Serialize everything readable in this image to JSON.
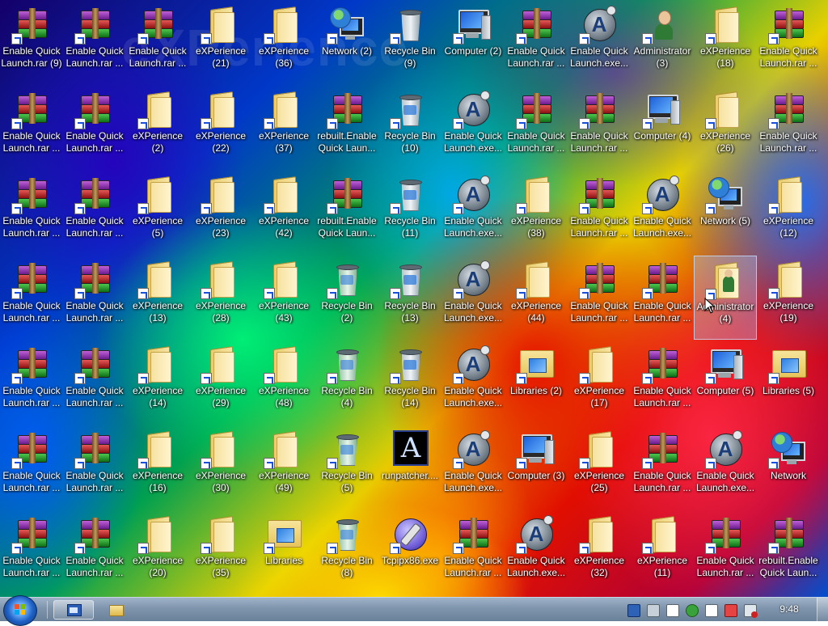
{
  "wallpaper": {
    "brand_text": "eXPerience"
  },
  "desktop_icons": [
    {
      "type": "rar",
      "label": "Enable Quick\nLaunch.rar (9)"
    },
    {
      "type": "rar",
      "label": "Enable Quick\nLaunch.rar ..."
    },
    {
      "type": "rar",
      "label": "Enable Quick\nLaunch.rar ..."
    },
    {
      "type": "folder",
      "label": "eXPerience\n(21)"
    },
    {
      "type": "folder",
      "label": "eXPerience\n(36)"
    },
    {
      "type": "network",
      "label": "Network (2)"
    },
    {
      "type": "bin-empty",
      "label": "Recycle Bin\n(9)"
    },
    {
      "type": "computer",
      "label": "Computer (2)"
    },
    {
      "type": "rar",
      "label": "Enable Quick\nLaunch.rar ..."
    },
    {
      "type": "exe",
      "label": "Enable Quick\nLaunch.exe..."
    },
    {
      "type": "user",
      "label": "Administrator\n(3)"
    },
    {
      "type": "folder",
      "label": "eXPerience\n(18)"
    },
    {
      "type": "rar",
      "label": "Enable Quick\nLaunch.rar ..."
    },
    {
      "type": "rar",
      "label": "Enable Quick\nLaunch.rar ..."
    },
    {
      "type": "rar",
      "label": "Enable Quick\nLaunch.rar ..."
    },
    {
      "type": "folder",
      "label": "eXPerience\n(2)"
    },
    {
      "type": "folder",
      "label": "eXPerience\n(22)"
    },
    {
      "type": "folder",
      "label": "eXPerience\n(37)"
    },
    {
      "type": "rar",
      "label": "rebuilt.Enable\nQuick Laun..."
    },
    {
      "type": "bin-full",
      "label": "Recycle Bin\n(10)"
    },
    {
      "type": "exe",
      "label": "Enable Quick\nLaunch.exe..."
    },
    {
      "type": "rar",
      "label": "Enable Quick\nLaunch.rar ..."
    },
    {
      "type": "rar",
      "label": "Enable Quick\nLaunch.rar ..."
    },
    {
      "type": "computer",
      "label": "Computer (4)"
    },
    {
      "type": "folder",
      "label": "eXPerience\n(26)"
    },
    {
      "type": "rar",
      "label": "Enable Quick\nLaunch.rar ..."
    },
    {
      "type": "rar",
      "label": "Enable Quick\nLaunch.rar ..."
    },
    {
      "type": "rar",
      "label": "Enable Quick\nLaunch.rar ..."
    },
    {
      "type": "folder",
      "label": "eXPerience\n(5)"
    },
    {
      "type": "folder",
      "label": "eXPerience\n(23)"
    },
    {
      "type": "folder",
      "label": "eXPerience\n(42)"
    },
    {
      "type": "rar",
      "label": "rebuilt.Enable\nQuick Laun..."
    },
    {
      "type": "bin-full",
      "label": "Recycle Bin\n(11)"
    },
    {
      "type": "exe",
      "label": "Enable Quick\nLaunch.exe..."
    },
    {
      "type": "folder",
      "label": "eXPerience\n(38)"
    },
    {
      "type": "rar",
      "label": "Enable Quick\nLaunch.rar ..."
    },
    {
      "type": "exe",
      "label": "Enable Quick\nLaunch.exe..."
    },
    {
      "type": "network",
      "label": "Network (5)"
    },
    {
      "type": "folder",
      "label": "eXPerience\n(12)"
    },
    {
      "type": "rar",
      "label": "Enable Quick\nLaunch.rar ..."
    },
    {
      "type": "rar",
      "label": "Enable Quick\nLaunch.rar ..."
    },
    {
      "type": "folder",
      "label": "eXPerience\n(13)"
    },
    {
      "type": "folder",
      "label": "eXPerience\n(28)"
    },
    {
      "type": "folder",
      "label": "eXPerience\n(43)"
    },
    {
      "type": "bin-green",
      "label": "Recycle Bin\n(2)"
    },
    {
      "type": "bin-full",
      "label": "Recycle Bin\n(13)"
    },
    {
      "type": "exe",
      "label": "Enable Quick\nLaunch.exe..."
    },
    {
      "type": "folder",
      "label": "eXPerience\n(44)"
    },
    {
      "type": "rar",
      "label": "Enable Quick\nLaunch.rar ..."
    },
    {
      "type": "rar",
      "label": "Enable Quick\nLaunch.rar ..."
    },
    {
      "type": "user-folder",
      "label": "Administrator\n(4)",
      "selected": true
    },
    {
      "type": "folder",
      "label": "eXPerience\n(19)"
    },
    {
      "type": "rar",
      "label": "Enable Quick\nLaunch.rar ..."
    },
    {
      "type": "rar",
      "label": "Enable Quick\nLaunch.rar ..."
    },
    {
      "type": "folder",
      "label": "eXPerience\n(14)"
    },
    {
      "type": "folder",
      "label": "eXPerience\n(29)"
    },
    {
      "type": "folder",
      "label": "eXPerience\n(48)"
    },
    {
      "type": "bin-green",
      "label": "Recycle Bin\n(4)"
    },
    {
      "type": "bin-full",
      "label": "Recycle Bin\n(14)"
    },
    {
      "type": "exe",
      "label": "Enable Quick\nLaunch.exe..."
    },
    {
      "type": "libraries",
      "label": "Libraries (2)"
    },
    {
      "type": "folder",
      "label": "eXPerience\n(17)"
    },
    {
      "type": "rar",
      "label": "Enable Quick\nLaunch.rar ..."
    },
    {
      "type": "computer",
      "label": "Computer (5)"
    },
    {
      "type": "libraries",
      "label": "Libraries (5)"
    },
    {
      "type": "rar",
      "label": "Enable Quick\nLaunch.rar ..."
    },
    {
      "type": "rar",
      "label": "Enable Quick\nLaunch.rar ..."
    },
    {
      "type": "folder",
      "label": "eXPerience\n(16)"
    },
    {
      "type": "folder",
      "label": "eXPerience\n(30)"
    },
    {
      "type": "folder",
      "label": "eXPerience\n(49)"
    },
    {
      "type": "bin-green",
      "label": "Recycle Bin\n(5)"
    },
    {
      "type": "runpatcher",
      "label": "runpatcher...."
    },
    {
      "type": "exe",
      "label": "Enable Quick\nLaunch.exe..."
    },
    {
      "type": "computer",
      "label": "Computer (3)"
    },
    {
      "type": "folder",
      "label": "eXPerience\n(25)"
    },
    {
      "type": "rar",
      "label": "Enable Quick\nLaunch.rar ..."
    },
    {
      "type": "exe",
      "label": "Enable Quick\nLaunch.exe..."
    },
    {
      "type": "network",
      "label": "Network"
    },
    {
      "type": "rar",
      "label": "Enable Quick\nLaunch.rar ..."
    },
    {
      "type": "rar",
      "label": "Enable Quick\nLaunch.rar ..."
    },
    {
      "type": "folder",
      "label": "eXPerience\n(20)"
    },
    {
      "type": "folder",
      "label": "eXPerience\n(35)"
    },
    {
      "type": "libraries",
      "label": "Libraries"
    },
    {
      "type": "bin-green",
      "label": "Recycle Bin\n(8)"
    },
    {
      "type": "tcpip",
      "label": "Tcpipx86.exe"
    },
    {
      "type": "rar",
      "label": "Enable Quick\nLaunch.rar ..."
    },
    {
      "type": "exe",
      "label": "Enable Quick\nLaunch.exe..."
    },
    {
      "type": "folder",
      "label": "eXPerience\n(32)"
    },
    {
      "type": "folder",
      "label": "eXPerience\n(11)"
    },
    {
      "type": "rar",
      "label": "Enable Quick\nLaunch.rar ..."
    },
    {
      "type": "rar",
      "label": "rebuilt.Enable\nQuick Laun..."
    }
  ],
  "taskbar": {
    "pinned": [
      {
        "name": "explorer-window",
        "icon": "window-icon",
        "active": true
      },
      {
        "name": "libraries-folder",
        "icon": "folder-icon",
        "active": false
      }
    ],
    "tray_icons": [
      "monitor-icon",
      "network-icon",
      "document-icon",
      "security-icon",
      "flag-icon",
      "battery-icon",
      "volume-muted-icon"
    ],
    "clock": "9:48"
  }
}
